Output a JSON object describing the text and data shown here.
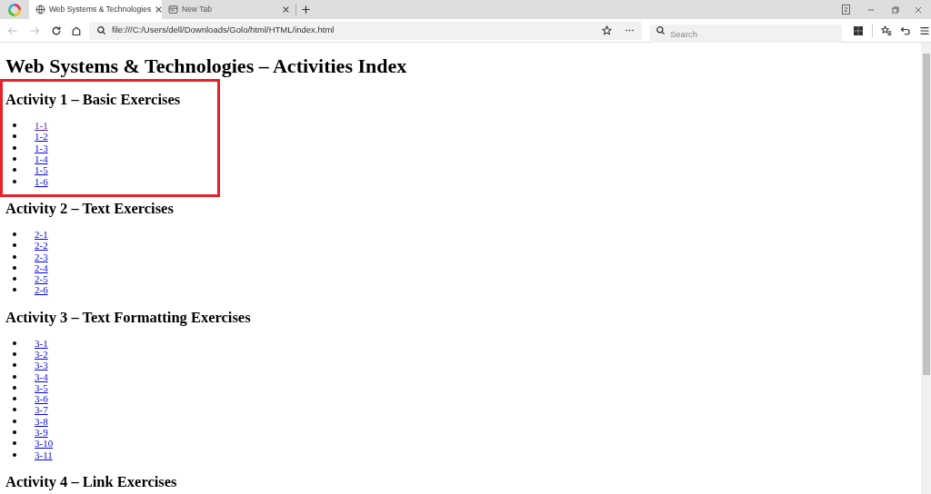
{
  "browser": {
    "tabs": [
      {
        "title": "Web Systems & Technologies",
        "selected": true,
        "kind": "page"
      },
      {
        "title": "New Tab",
        "selected": false,
        "kind": "newtab"
      }
    ],
    "tab_count": "2",
    "nav": {
      "back_disabled": true,
      "forward_disabled": true
    },
    "address": "file:///C:/Users/dell/Downloads/Golo/html/HTML/index.html",
    "search": {
      "placeholder": "Search"
    }
  },
  "page": {
    "title": "Web Systems & Technologies – Activities Index",
    "sections": [
      {
        "heading": "Activity 1 – Basic Exercises",
        "links": [
          {
            "text": "1-1",
            "visited": true
          },
          {
            "text": "1-2",
            "visited": false
          },
          {
            "text": "1-3",
            "visited": false
          },
          {
            "text": "1-4",
            "visited": false
          },
          {
            "text": "1-5",
            "visited": false
          },
          {
            "text": "1-6",
            "visited": false
          }
        ]
      },
      {
        "heading": "Activity 2 – Text Exercises",
        "links": [
          {
            "text": "2-1",
            "visited": false
          },
          {
            "text": "2-2",
            "visited": false
          },
          {
            "text": "2-3",
            "visited": false
          },
          {
            "text": "2-4",
            "visited": false
          },
          {
            "text": "2-5",
            "visited": false
          },
          {
            "text": "2-6",
            "visited": false
          }
        ]
      },
      {
        "heading": "Activity 3 – Text Formatting Exercises",
        "links": [
          {
            "text": "3-1",
            "visited": false
          },
          {
            "text": "3-2",
            "visited": false
          },
          {
            "text": "3-3",
            "visited": false
          },
          {
            "text": "3-4",
            "visited": false
          },
          {
            "text": "3-5",
            "visited": false
          },
          {
            "text": "3-6",
            "visited": false
          },
          {
            "text": "3-7",
            "visited": false
          },
          {
            "text": "3-8",
            "visited": false
          },
          {
            "text": "3-9",
            "visited": false
          },
          {
            "text": "3-10",
            "visited": false
          },
          {
            "text": "3-11",
            "visited": false
          }
        ]
      },
      {
        "heading": "Activity 4 – Link Exercises"
      }
    ]
  },
  "annotation_box": true
}
